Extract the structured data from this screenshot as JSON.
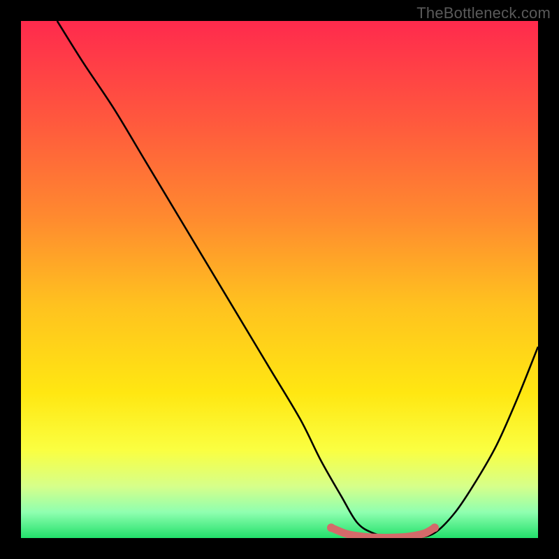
{
  "watermark": "TheBottleneck.com",
  "chart_data": {
    "type": "line",
    "title": "",
    "xlabel": "",
    "ylabel": "",
    "xlim": [
      0,
      100
    ],
    "ylim": [
      0,
      100
    ],
    "grid": false,
    "legend": false,
    "gradient_stops": [
      {
        "offset": 0.0,
        "color": "#ff2a4d"
      },
      {
        "offset": 0.2,
        "color": "#ff5a3d"
      },
      {
        "offset": 0.38,
        "color": "#ff8a2f"
      },
      {
        "offset": 0.55,
        "color": "#ffc21f"
      },
      {
        "offset": 0.72,
        "color": "#ffe712"
      },
      {
        "offset": 0.83,
        "color": "#faff41"
      },
      {
        "offset": 0.9,
        "color": "#d6ff8a"
      },
      {
        "offset": 0.95,
        "color": "#8fffb0"
      },
      {
        "offset": 1.0,
        "color": "#22e06b"
      }
    ],
    "series": [
      {
        "name": "bottleneck-curve",
        "color": "#000000",
        "x": [
          7,
          12,
          18,
          24,
          30,
          36,
          42,
          48,
          54,
          58,
          62,
          65,
          68,
          72,
          76,
          80,
          84,
          88,
          92,
          96,
          100
        ],
        "values": [
          100,
          92,
          83,
          73,
          63,
          53,
          43,
          33,
          23,
          15,
          8,
          3,
          1,
          0,
          0,
          1,
          5,
          11,
          18,
          27,
          37
        ]
      }
    ],
    "highlight": {
      "name": "bottleneck-zone",
      "color": "#d46a6a",
      "x": [
        60,
        63,
        66,
        69,
        72,
        75,
        78,
        80
      ],
      "values": [
        2.0,
        0.8,
        0.3,
        0.1,
        0.1,
        0.3,
        0.9,
        2.0
      ]
    }
  }
}
